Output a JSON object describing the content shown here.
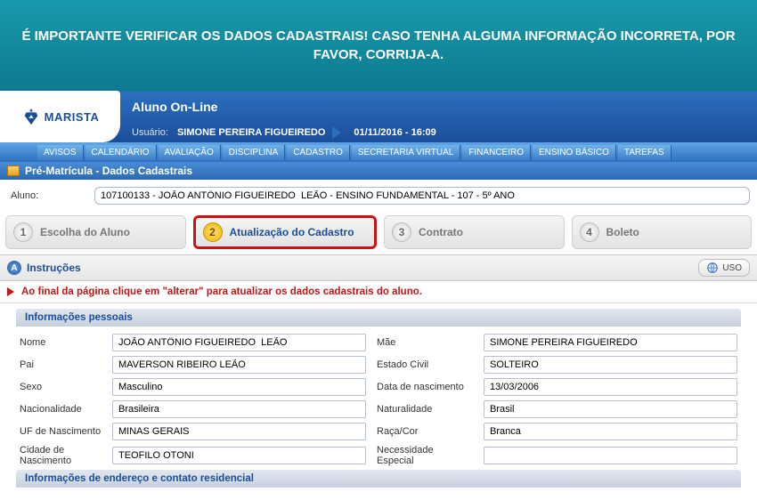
{
  "banner": {
    "text": "É IMPORTANTE VERIFICAR OS DADOS CADASTRAIS! CASO TENHA ALGUMA INFORMAÇÃO INCORRETA, POR FAVOR, CORRIJA-A."
  },
  "header": {
    "brand": "MARISTA",
    "app_title": "Aluno On-Line",
    "user_label": "Usuário:",
    "user_name": "SIMONE PEREIRA FIGUEIREDO",
    "datetime": "01/11/2016 - 16:09"
  },
  "menu": {
    "items": [
      "AVISOS",
      "CALENDÁRIO",
      "AVALIAÇÃO",
      "DISCIPLINA",
      "CADASTRO",
      "SECRETARIA VIRTUAL",
      "FINANCEIRO",
      "ENSINO BÁSICO",
      "TAREFAS"
    ]
  },
  "section": {
    "title": "Pré-Matrícula - Dados Cadastrais"
  },
  "aluno": {
    "label": "Aluno:",
    "value": "107100133 - JOÃO ANTÔNIO FIGUEIREDO  LEÃO - ENSINO FUNDAMENTAL - 107 - 5º ANO"
  },
  "steps": {
    "items": [
      {
        "num": "1",
        "label": "Escolha do Aluno"
      },
      {
        "num": "2",
        "label": "Atualização do Cadastro"
      },
      {
        "num": "3",
        "label": "Contrato"
      },
      {
        "num": "4",
        "label": "Boleto"
      }
    ],
    "active_index": 1
  },
  "instructions": {
    "badge": "A",
    "label": "Instruções",
    "uso_label": "USO"
  },
  "alert": {
    "text": "Ao final da página clique em \"alterar\" para atualizar os dados cadastrais do aluno."
  },
  "personal": {
    "title": "Informações pessoais",
    "labels": {
      "nome": "Nome",
      "mae": "Mãe",
      "pai": "Pai",
      "estado_civil": "Estado Civil",
      "sexo": "Sexo",
      "data_nasc": "Data de nascimento",
      "nacionalidade": "Nacionalidade",
      "naturalidade": "Naturalidade",
      "uf_nasc": "UF de Nascimento",
      "raca": "Raça/Cor",
      "cidade_nasc": "Cidade de Nascimento",
      "necessidade": "Necessidade Especial"
    },
    "values": {
      "nome": "JOÃO ANTÔNIO FIGUEIREDO  LEÃO",
      "mae": "SIMONE PEREIRA FIGUEIREDO",
      "pai": "MAVERSON RIBEIRO LEÃO",
      "estado_civil": "SOLTEIRO",
      "sexo": "Masculino",
      "data_nasc": "13/03/2006",
      "nacionalidade": "Brasileira",
      "naturalidade": "Brasil",
      "uf_nasc": "MINAS GERAIS",
      "raca": "Branca",
      "cidade_nasc": "TEOFILO OTONI",
      "necessidade": ""
    }
  },
  "next_panel": {
    "title": "Informações de endereço e contato residencial"
  }
}
